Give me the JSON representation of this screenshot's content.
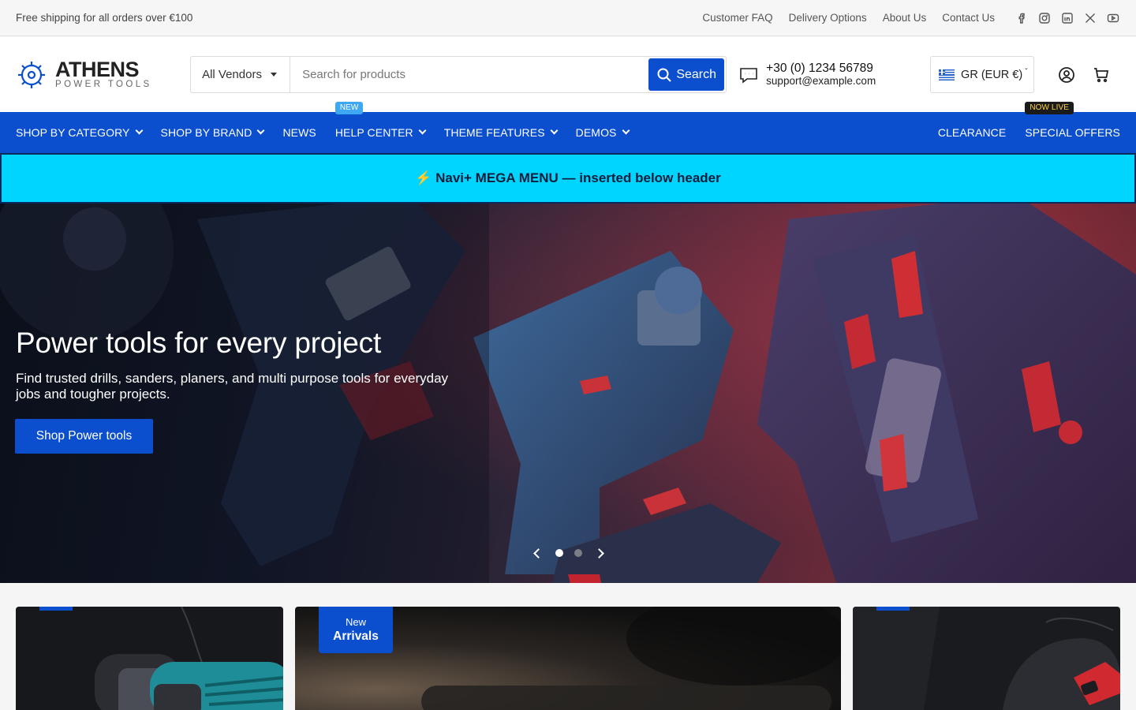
{
  "topbar": {
    "promo": "Free shipping for all orders over €100",
    "links": [
      "Customer FAQ",
      "Delivery Options",
      "About Us",
      "Contact Us"
    ],
    "social": [
      "facebook-icon",
      "instagram-icon",
      "linkedin-icon",
      "x-icon",
      "youtube-icon"
    ]
  },
  "header": {
    "logo": {
      "name": "ATHENS",
      "sub": "POWER TOOLS"
    },
    "vendor_select": "All Vendors",
    "search_placeholder": "Search for products",
    "search_button": "Search",
    "phone": "+30 (0) 1234 56789",
    "email": "support@example.com",
    "currency": "GR (EUR €)"
  },
  "nav": {
    "left": [
      {
        "label": "SHOP BY CATEGORY",
        "dropdown": true
      },
      {
        "label": "SHOP BY BRAND",
        "dropdown": true
      },
      {
        "label": "NEWS",
        "dropdown": false
      },
      {
        "label": "HELP CENTER",
        "dropdown": true,
        "badge": "NEW"
      },
      {
        "label": "THEME FEATURES",
        "dropdown": true
      },
      {
        "label": "DEMOS",
        "dropdown": true
      }
    ],
    "right": [
      {
        "label": "CLEARANCE"
      },
      {
        "label": "SPECIAL OFFERS",
        "badge": "NOW LIVE"
      }
    ]
  },
  "mega_banner": "⚡ Navi+ MEGA MENU — inserted below header",
  "hero": {
    "title": "Power tools for every project",
    "text": "Find trusted drills, sanders, planers, and multi purpose tools for everyday jobs and tougher projects.",
    "cta": "Shop Power tools",
    "slides": 2,
    "active_slide": 1
  },
  "cards": {
    "middle_label_a": "New",
    "middle_label_b": "Arrivals"
  },
  "colors": {
    "brand_blue": "#0b4fce",
    "banner_cyan": "#00d5ff",
    "badge_new": "#3fa8f2",
    "badge_live_text": "#ffd43b"
  }
}
